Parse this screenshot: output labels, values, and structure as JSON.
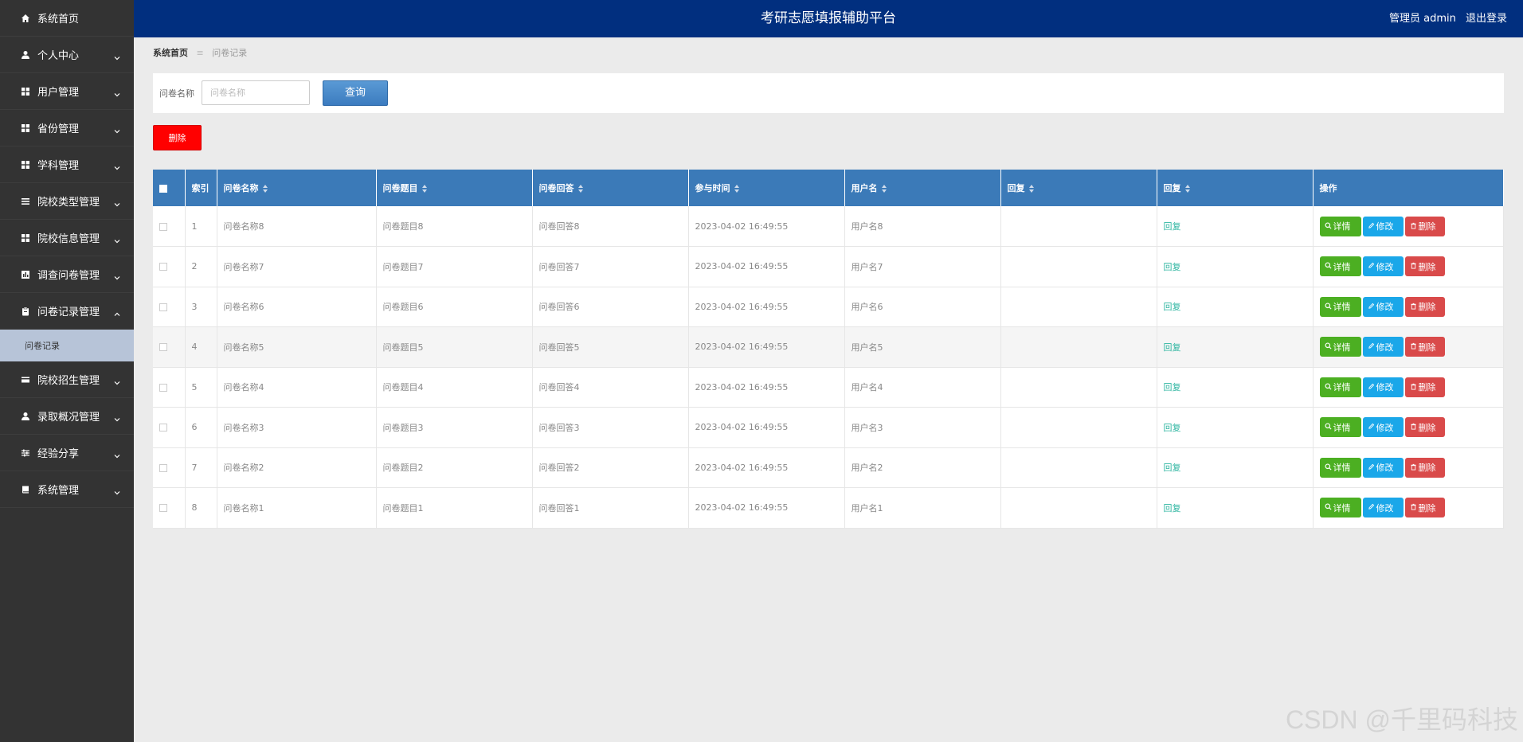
{
  "header": {
    "title": "考研志愿填报辅助平台",
    "user_label": "管理员 admin",
    "logout_label": "退出登录"
  },
  "sidebar": {
    "items": [
      {
        "label": "系统首页",
        "icon": "home-icon"
      },
      {
        "label": "个人中心",
        "icon": "user-icon"
      },
      {
        "label": "用户管理",
        "icon": "grid-icon"
      },
      {
        "label": "省份管理",
        "icon": "grid-icon"
      },
      {
        "label": "学科管理",
        "icon": "grid-icon"
      },
      {
        "label": "院校类型管理",
        "icon": "list-icon"
      },
      {
        "label": "院校信息管理",
        "icon": "grid-icon"
      },
      {
        "label": "调查问卷管理",
        "icon": "chart-icon"
      },
      {
        "label": "问卷记录管理",
        "icon": "clipboard-icon"
      },
      {
        "label": "院校招生管理",
        "icon": "card-icon"
      },
      {
        "label": "录取概况管理",
        "icon": "user-icon"
      },
      {
        "label": "经验分享",
        "icon": "sliders-icon"
      },
      {
        "label": "系统管理",
        "icon": "book-icon"
      }
    ],
    "sub_item": "问卷记录"
  },
  "breadcrumb": {
    "home": "系统首页",
    "sep": "≡",
    "current": "问卷记录"
  },
  "search": {
    "label": "问卷名称",
    "placeholder": "问卷名称",
    "query_label": "查询"
  },
  "delete_label": "删除",
  "table": {
    "headers": [
      "索引",
      "问卷名称",
      "问卷题目",
      "问卷回答",
      "参与时间",
      "用户名",
      "回复",
      "回复",
      "操作"
    ],
    "rows": [
      {
        "index": "1",
        "name": "问卷名称8",
        "topic": "问卷题目8",
        "answer": "问卷回答8",
        "time": "2023-04-02 16:49:55",
        "user": "用户名8"
      },
      {
        "index": "2",
        "name": "问卷名称7",
        "topic": "问卷题目7",
        "answer": "问卷回答7",
        "time": "2023-04-02 16:49:55",
        "user": "用户名7"
      },
      {
        "index": "3",
        "name": "问卷名称6",
        "topic": "问卷题目6",
        "answer": "问卷回答6",
        "time": "2023-04-02 16:49:55",
        "user": "用户名6"
      },
      {
        "index": "4",
        "name": "问卷名称5",
        "topic": "问卷题目5",
        "answer": "问卷回答5",
        "time": "2023-04-02 16:49:55",
        "user": "用户名5"
      },
      {
        "index": "5",
        "name": "问卷名称4",
        "topic": "问卷题目4",
        "answer": "问卷回答4",
        "time": "2023-04-02 16:49:55",
        "user": "用户名4"
      },
      {
        "index": "6",
        "name": "问卷名称3",
        "topic": "问卷题目3",
        "answer": "问卷回答3",
        "time": "2023-04-02 16:49:55",
        "user": "用户名3"
      },
      {
        "index": "7",
        "name": "问卷名称2",
        "topic": "问卷题目2",
        "answer": "问卷回答2",
        "time": "2023-04-02 16:49:55",
        "user": "用户名2"
      },
      {
        "index": "8",
        "name": "问卷名称1",
        "topic": "问卷题目1",
        "answer": "问卷回答1",
        "time": "2023-04-02 16:49:55",
        "user": "用户名1"
      }
    ],
    "reply_link": "回复",
    "detail_label": "详情",
    "edit_label": "修改",
    "delete_label": "删除"
  },
  "watermark": "CSDN @千里码科技",
  "colors": {
    "header_bg": "#012f7f",
    "sidebar_bg": "#333333",
    "table_header_bg": "#3b7ab8",
    "detail_btn": "#4caf22",
    "edit_btn": "#1aa7e9",
    "delete_btn": "#d94a4a",
    "danger": "#ff0000"
  }
}
